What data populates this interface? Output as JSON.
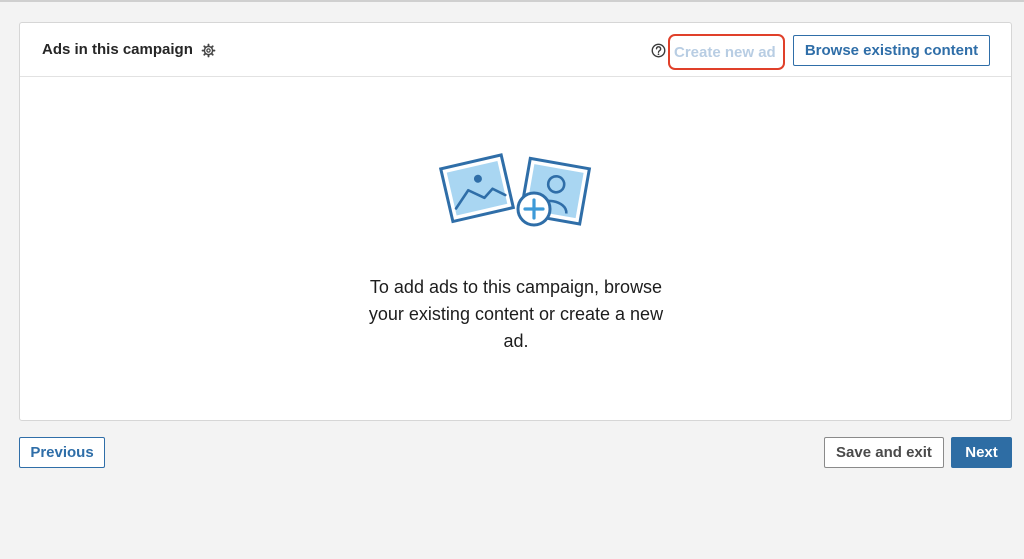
{
  "card": {
    "title": "Ads in this campaign",
    "create_label": "Create new ad",
    "browse_label": "Browse existing content",
    "empty_message": "To add ads to this campaign, browse your existing content or create a new ad."
  },
  "footer": {
    "previous_label": "Previous",
    "save_exit_label": "Save and exit",
    "next_label": "Next"
  },
  "icons": {
    "settings": "gear-icon",
    "help": "help-circle-icon",
    "illustration": "add-image-content-illustration"
  },
  "colors": {
    "accent": "#2f6ea8",
    "primary_button": "#2e6da4",
    "disabled_text": "#b8cde3",
    "highlight": "#e0402a",
    "illustration_fill": "#a9d6f2"
  }
}
